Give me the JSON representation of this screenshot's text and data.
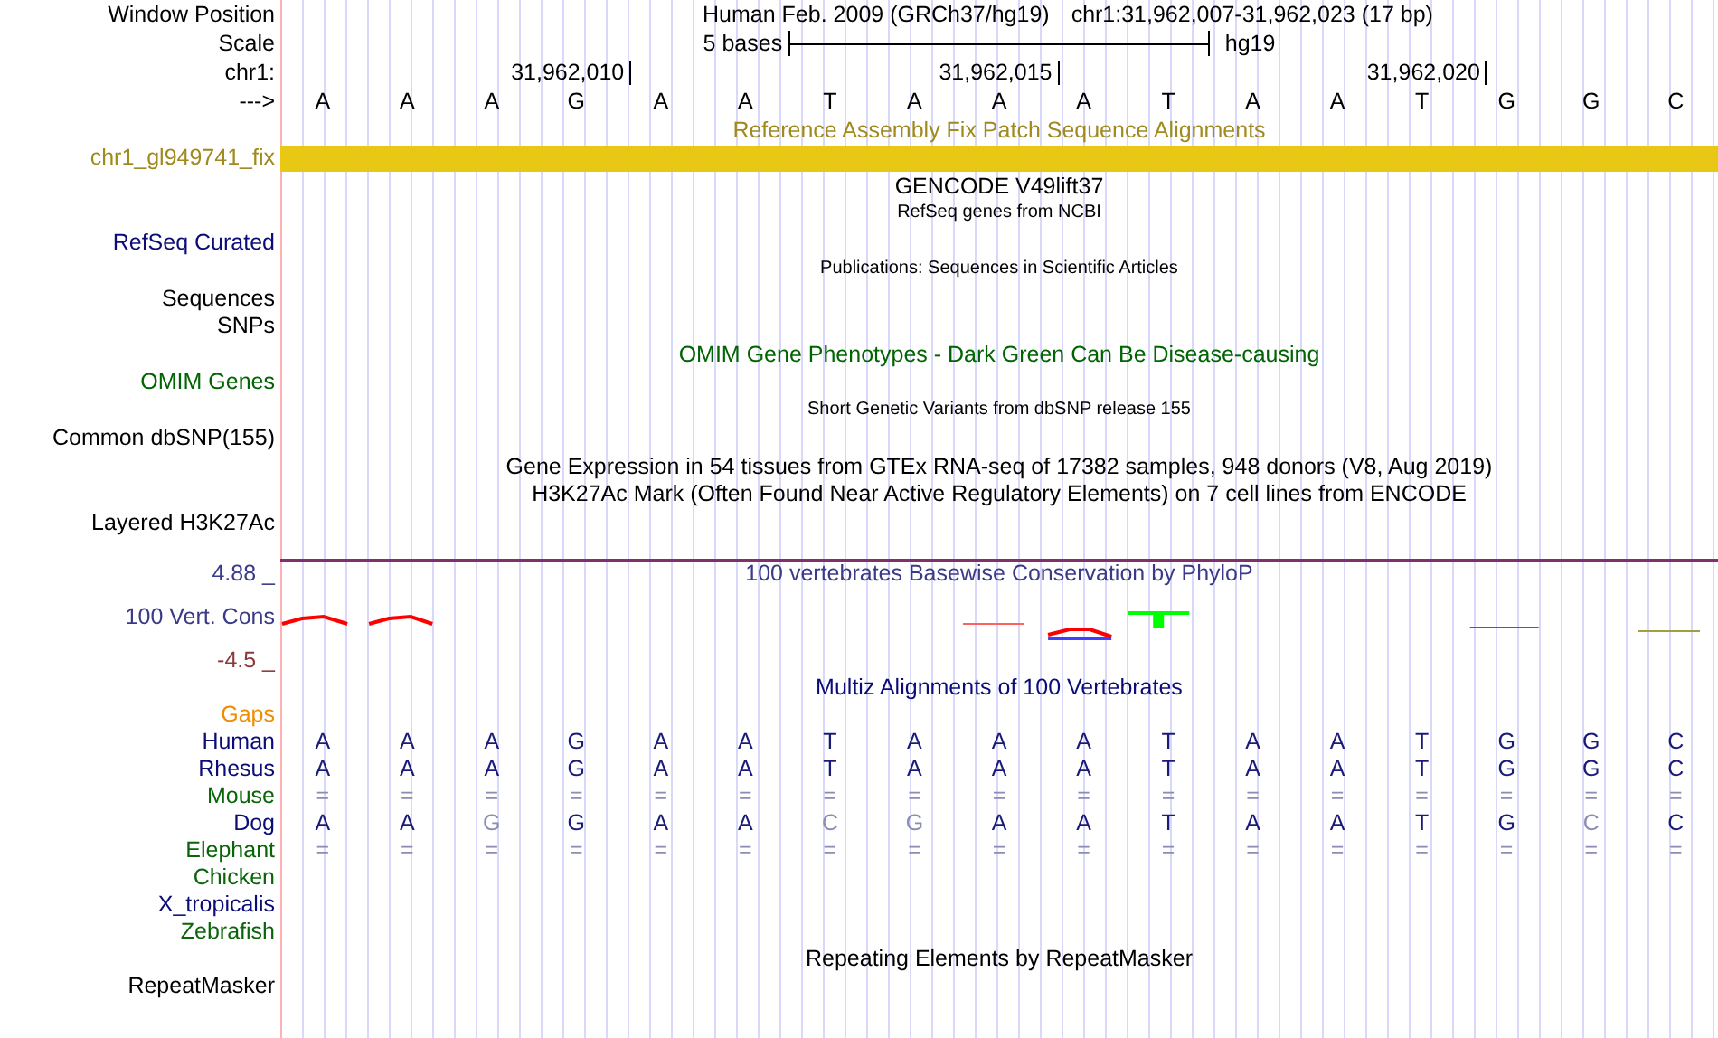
{
  "header": {
    "label": "Window Position",
    "assembly": "Human Feb. 2009 (GRCh37/hg19)",
    "position": "chr1:31,962,007-31,962,023 (17 bp)"
  },
  "scale": {
    "label": "Scale",
    "length": "5 bases",
    "db": "hg19"
  },
  "ruler": {
    "label": "chr1:",
    "strand": "--->",
    "bases": [
      {
        "base": "A"
      },
      {
        "base": "A"
      },
      {
        "base": "A"
      },
      {
        "base": "G",
        "tick": "31,962,010"
      },
      {
        "base": "A"
      },
      {
        "base": "A"
      },
      {
        "base": "T"
      },
      {
        "base": "A"
      },
      {
        "base": "A",
        "tick": "31,962,015"
      },
      {
        "base": "A"
      },
      {
        "base": "T"
      },
      {
        "base": "A"
      },
      {
        "base": "A"
      },
      {
        "base": "T",
        "tick": "31,962,020"
      },
      {
        "base": "G"
      },
      {
        "base": "G"
      },
      {
        "base": "C"
      }
    ]
  },
  "tracks": [
    {
      "kind": "title",
      "text": "Reference Assembly Fix Patch Sequence Alignments",
      "color": "#a08a1e"
    },
    {
      "kind": "bar",
      "label": "chr1_gl949741_fix",
      "color": "#a08a1e"
    },
    {
      "kind": "title",
      "text": "GENCODE V49lift37",
      "color": "#000000"
    },
    {
      "kind": "small",
      "text": "RefSeq genes from NCBI",
      "color": "#000000"
    },
    {
      "kind": "label",
      "label": "RefSeq Curated",
      "color": "#0c0c78"
    },
    {
      "kind": "small",
      "text": "Publications: Sequences in Scientific Articles",
      "color": "#000000"
    },
    {
      "kind": "label",
      "label": "Sequences",
      "color": "#000000"
    },
    {
      "kind": "label",
      "label": "SNPs",
      "color": "#000000"
    },
    {
      "kind": "title",
      "text": "OMIM Gene Phenotypes - Dark Green Can Be Disease-causing",
      "color": "#006400"
    },
    {
      "kind": "label",
      "label": "OMIM Genes",
      "color": "#006400"
    },
    {
      "kind": "small",
      "text": "Short Genetic Variants from dbSNP release 155",
      "color": "#000000"
    },
    {
      "kind": "label",
      "label": "Common dbSNP(155)",
      "color": "#000000"
    },
    {
      "kind": "title",
      "text": "Gene Expression in 54 tissues from GTEx RNA-seq of 17382 samples, 948 donors (V8, Aug 2019)",
      "color": "#000000"
    },
    {
      "kind": "title",
      "text": "H3K27Ac Mark (Often Found Near Active Regulatory Elements) on 7 cell lines from ENCODE",
      "color": "#000000"
    },
    {
      "kind": "label",
      "label": "Layered H3K27Ac",
      "color": "#000000"
    }
  ],
  "conservation": {
    "title": "100 vertebrates Basewise Conservation by PhyloP",
    "label": "100 Vert. Cons",
    "max": "4.88 _",
    "min": "-4.5 _"
  },
  "multiz": {
    "title": "Multiz Alignments of 100 Vertebrates",
    "gaps": "Gaps",
    "species": [
      {
        "name": "Human",
        "color": "#0c0c78",
        "bases": [
          {
            "base": "A",
            "faded": false
          },
          {
            "base": "A",
            "faded": false
          },
          {
            "base": "A",
            "faded": false
          },
          {
            "base": "G",
            "faded": false
          },
          {
            "base": "A",
            "faded": false
          },
          {
            "base": "A",
            "faded": false
          },
          {
            "base": "T",
            "faded": false
          },
          {
            "base": "A",
            "faded": false
          },
          {
            "base": "A",
            "faded": false
          },
          {
            "base": "A",
            "faded": false
          },
          {
            "base": "T",
            "faded": false
          },
          {
            "base": "A",
            "faded": false
          },
          {
            "base": "A",
            "faded": false
          },
          {
            "base": "T",
            "faded": false
          },
          {
            "base": "G",
            "faded": false
          },
          {
            "base": "G",
            "faded": false
          },
          {
            "base": "C",
            "faded": false
          }
        ]
      },
      {
        "name": "Rhesus",
        "color": "#0c0c78",
        "bases": [
          {
            "base": "A",
            "faded": false
          },
          {
            "base": "A",
            "faded": false
          },
          {
            "base": "A",
            "faded": false
          },
          {
            "base": "G",
            "faded": false
          },
          {
            "base": "A",
            "faded": false
          },
          {
            "base": "A",
            "faded": false
          },
          {
            "base": "T",
            "faded": false
          },
          {
            "base": "A",
            "faded": false
          },
          {
            "base": "A",
            "faded": false
          },
          {
            "base": "A",
            "faded": false
          },
          {
            "base": "T",
            "faded": false
          },
          {
            "base": "A",
            "faded": false
          },
          {
            "base": "A",
            "faded": false
          },
          {
            "base": "T",
            "faded": false
          },
          {
            "base": "G",
            "faded": false
          },
          {
            "base": "G",
            "faded": false
          },
          {
            "base": "C",
            "faded": false
          }
        ]
      },
      {
        "name": "Mouse",
        "color": "#0a640a",
        "bases": [
          {
            "base": "=",
            "faded": true
          },
          {
            "base": "=",
            "faded": true
          },
          {
            "base": "=",
            "faded": true
          },
          {
            "base": "=",
            "faded": true
          },
          {
            "base": "=",
            "faded": true
          },
          {
            "base": "=",
            "faded": true
          },
          {
            "base": "=",
            "faded": true
          },
          {
            "base": "=",
            "faded": true
          },
          {
            "base": "=",
            "faded": true
          },
          {
            "base": "=",
            "faded": true
          },
          {
            "base": "=",
            "faded": true
          },
          {
            "base": "=",
            "faded": true
          },
          {
            "base": "=",
            "faded": true
          },
          {
            "base": "=",
            "faded": true
          },
          {
            "base": "=",
            "faded": true
          },
          {
            "base": "=",
            "faded": true
          },
          {
            "base": "=",
            "faded": true
          }
        ]
      },
      {
        "name": "Dog",
        "color": "#0c0c78",
        "bases": [
          {
            "base": "A",
            "faded": false
          },
          {
            "base": "A",
            "faded": false
          },
          {
            "base": "G",
            "faded": true
          },
          {
            "base": "G",
            "faded": false
          },
          {
            "base": "A",
            "faded": false
          },
          {
            "base": "A",
            "faded": false
          },
          {
            "base": "C",
            "faded": true
          },
          {
            "base": "G",
            "faded": true
          },
          {
            "base": "A",
            "faded": false
          },
          {
            "base": "A",
            "faded": false
          },
          {
            "base": "T",
            "faded": false
          },
          {
            "base": "A",
            "faded": false
          },
          {
            "base": "A",
            "faded": false
          },
          {
            "base": "T",
            "faded": false
          },
          {
            "base": "G",
            "faded": false
          },
          {
            "base": "C",
            "faded": true
          },
          {
            "base": "C",
            "faded": false
          }
        ]
      },
      {
        "name": "Elephant",
        "color": "#0a640a",
        "bases": [
          {
            "base": "=",
            "faded": true
          },
          {
            "base": "=",
            "faded": true
          },
          {
            "base": "=",
            "faded": true
          },
          {
            "base": "=",
            "faded": true
          },
          {
            "base": "=",
            "faded": true
          },
          {
            "base": "=",
            "faded": true
          },
          {
            "base": "=",
            "faded": true
          },
          {
            "base": "=",
            "faded": true
          },
          {
            "base": "=",
            "faded": true
          },
          {
            "base": "=",
            "faded": true
          },
          {
            "base": "=",
            "faded": true
          },
          {
            "base": "=",
            "faded": true
          },
          {
            "base": "=",
            "faded": true
          },
          {
            "base": "=",
            "faded": true
          },
          {
            "base": "=",
            "faded": true
          },
          {
            "base": "=",
            "faded": true
          },
          {
            "base": "=",
            "faded": true
          }
        ]
      },
      {
        "name": "Chicken",
        "color": "#0a640a"
      },
      {
        "name": "X_tropicalis",
        "color": "#0c0c78"
      },
      {
        "name": "Zebrafish",
        "color": "#0a640a"
      }
    ]
  },
  "repeats": {
    "title": "Repeating Elements by RepeatMasker",
    "label": "RepeatMasker"
  }
}
